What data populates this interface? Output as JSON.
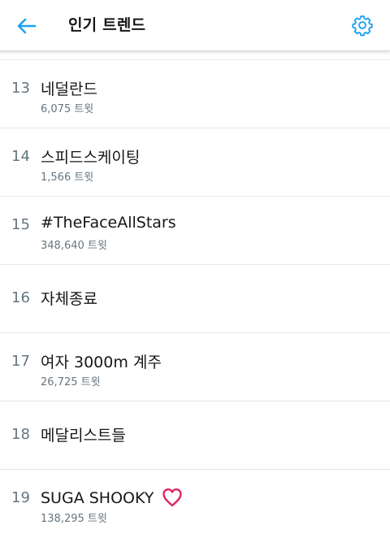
{
  "header": {
    "title": "인기 트렌드",
    "back_icon": "back-arrow-icon",
    "settings_icon": "gear-icon",
    "accent_color": "#1da1f2"
  },
  "trends": [
    {
      "rank": "13",
      "name": "네덜란드",
      "count": "6,075 트윗"
    },
    {
      "rank": "14",
      "name": "스피드스케이팅",
      "count": "1,566 트윗"
    },
    {
      "rank": "15",
      "name": "#TheFaceAllStars",
      "count": "348,640 트윗"
    },
    {
      "rank": "16",
      "name": "자체종료",
      "count": ""
    },
    {
      "rank": "17",
      "name": "여자 3000m 계주",
      "count": "26,725 트윗"
    },
    {
      "rank": "18",
      "name": "메달리스트들",
      "count": ""
    },
    {
      "rank": "19",
      "name": "SUGA SHOOKY",
      "count": "138,295 트윗",
      "emoji": "heart-icon"
    }
  ]
}
